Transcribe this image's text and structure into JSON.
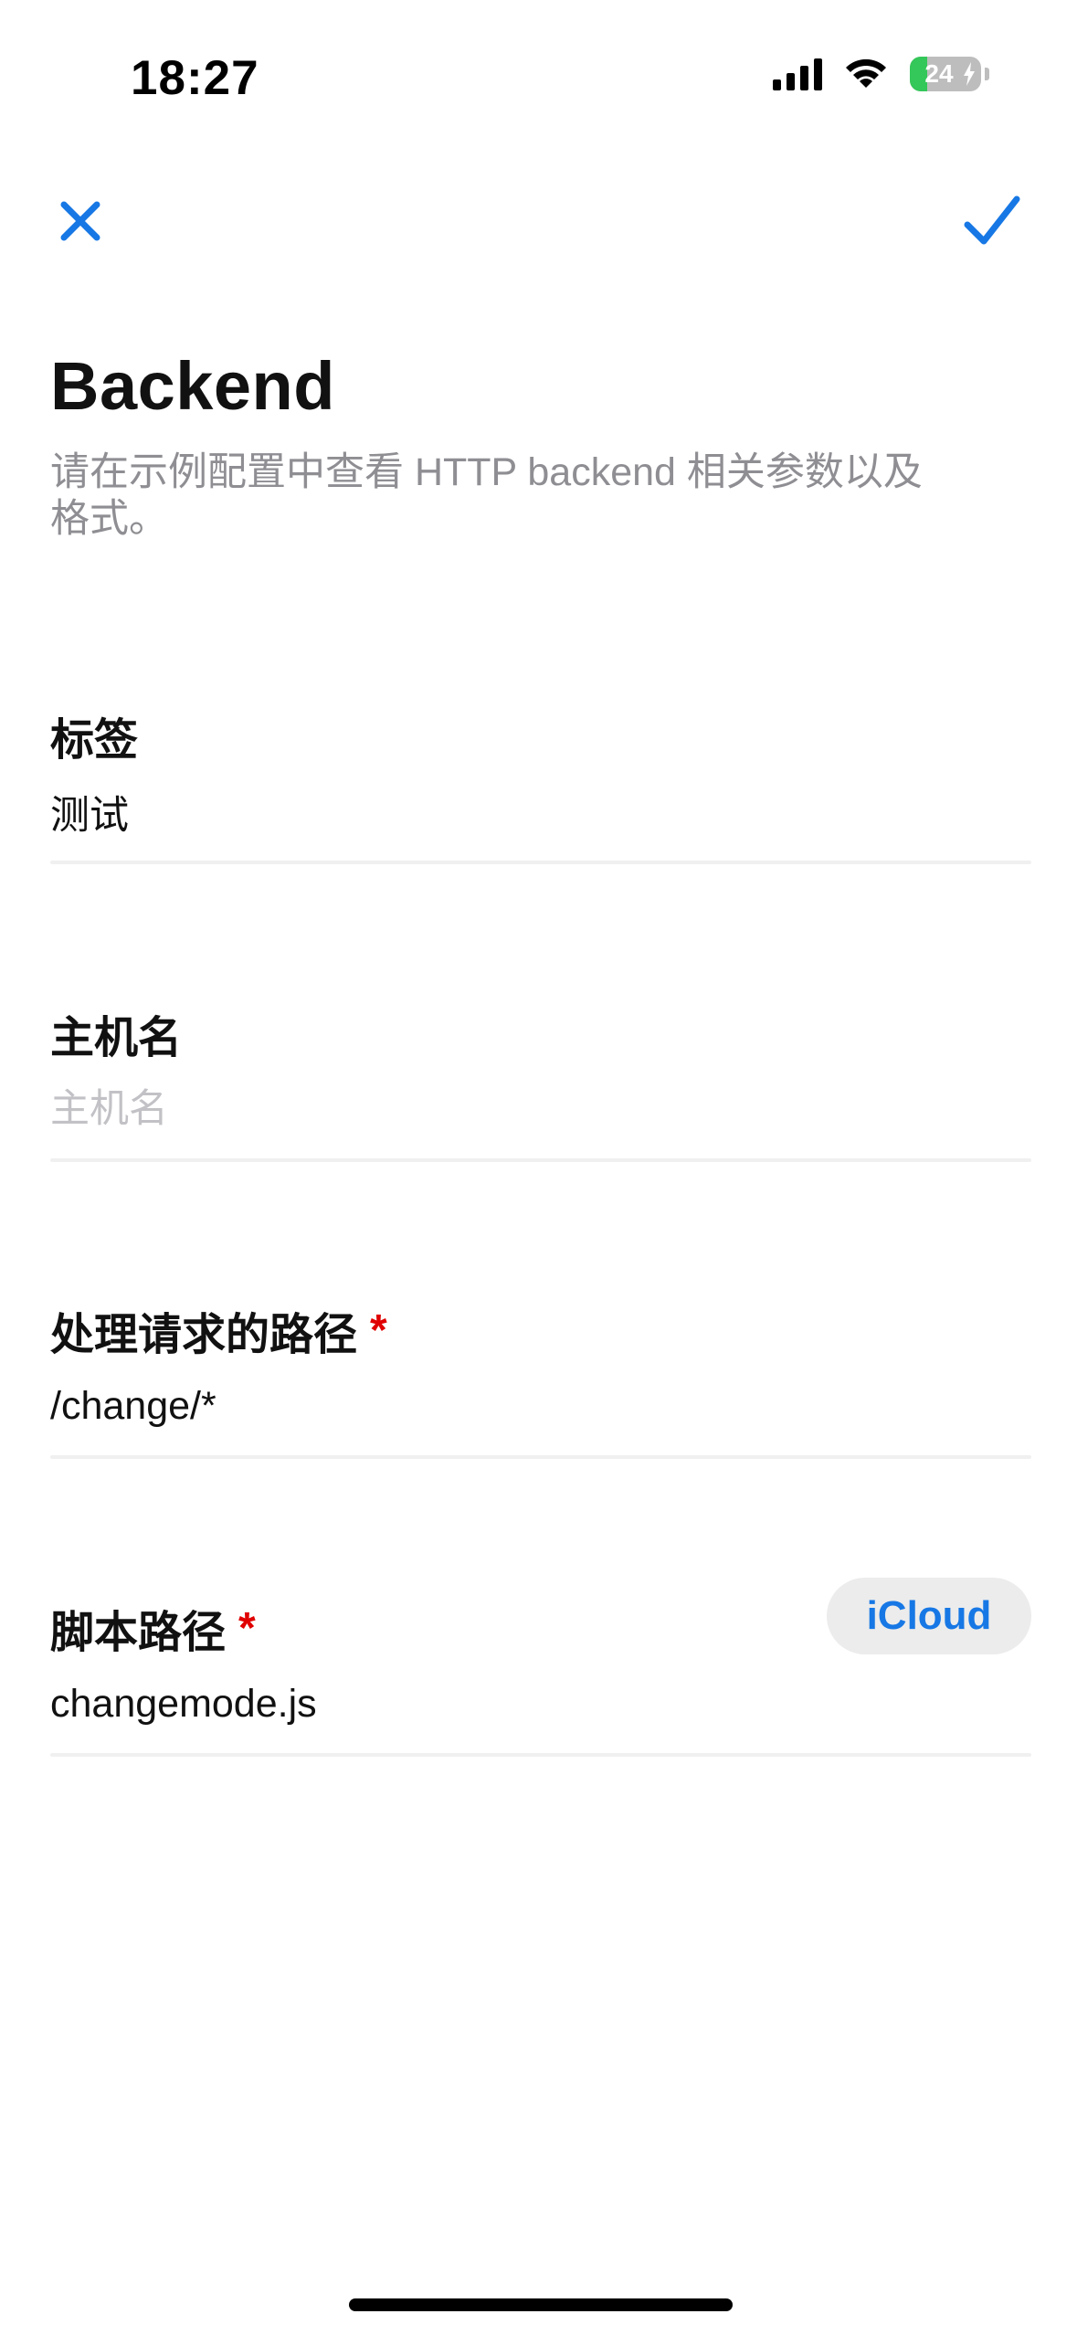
{
  "status_bar": {
    "time": "18:27",
    "battery": "24",
    "battery_level": 0.24,
    "icons": [
      "cellular-signal-icon",
      "wifi-icon",
      "battery-charging-icon"
    ]
  },
  "nav": {
    "close_icon": "close-icon",
    "done_icon": "checkmark-icon"
  },
  "header": {
    "title": "Backend",
    "subtitle": "请在示例配置中查看 HTTP backend 相关参数以及格式。"
  },
  "fields": {
    "label": {
      "title": "标签",
      "value": "测试",
      "placeholder": ""
    },
    "hostname": {
      "title": "主机名",
      "value": "",
      "placeholder": "主机名"
    },
    "request_path": {
      "title": "处理请求的路径",
      "required_mark": "*",
      "value": "/change/*",
      "placeholder": ""
    },
    "script_path": {
      "title": "脚本路径",
      "required_mark": "*",
      "value": "changemode.js",
      "placeholder": "",
      "action_label": "iCloud"
    }
  },
  "colors": {
    "accent": "#1778e5",
    "required": "#e00000",
    "placeholder": "#c2c2c6",
    "subtitle": "#8e8e93",
    "battery_green": "#34c759"
  }
}
